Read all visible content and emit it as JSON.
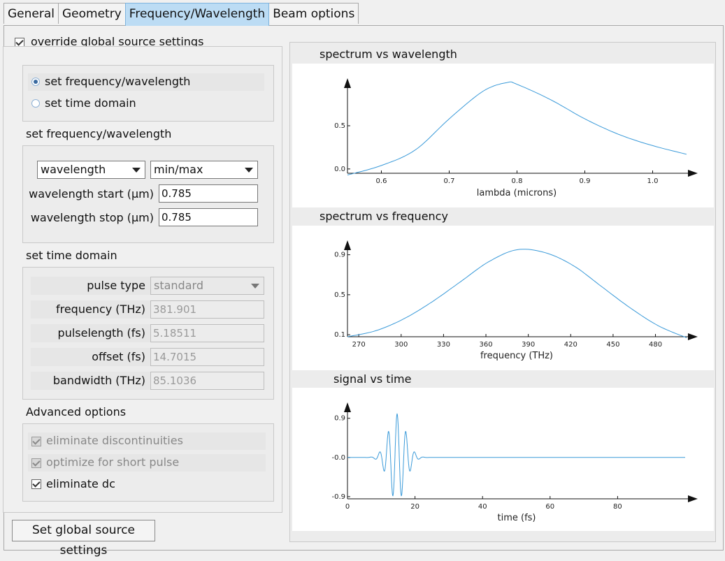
{
  "tabs": [
    "General",
    "Geometry",
    "Frequency/Wavelength",
    "Beam options"
  ],
  "override": {
    "label": "override global source settings",
    "checked": true
  },
  "mode": {
    "option1": "set frequency/wavelength",
    "option2": "set time domain",
    "selected": "set frequency/wavelength"
  },
  "freq_section": {
    "title": "set frequency/wavelength",
    "quantity_select": "wavelength",
    "range_select": "min/max",
    "start_label": "wavelength start (μm)",
    "start_value": "0.785",
    "stop_label": "wavelength stop (μm)",
    "stop_value": "0.785"
  },
  "time_section": {
    "title": "set time domain",
    "pulse_type_label": "pulse type",
    "pulse_type_value": "standard",
    "frequency_label": "frequency (THz)",
    "frequency_value": "381.901",
    "pulselength_label": "pulselength (fs)",
    "pulselength_value": "5.18511",
    "offset_label": "offset (fs)",
    "offset_value": "14.7015",
    "bandwidth_label": "bandwidth (THz)",
    "bandwidth_value": "85.1036"
  },
  "advanced": {
    "title": "Advanced options",
    "opt1": "eliminate discontinuities",
    "opt2": "optimize for short pulse",
    "opt3": "eliminate dc"
  },
  "set_global_button": "Set global source settings",
  "colors": {
    "tab_active": "#bcdcf4",
    "curve": "#3a9ad9"
  },
  "chart_data": [
    {
      "type": "line",
      "title": "spectrum vs wavelength",
      "xlabel": "lambda (microns)",
      "ylabel": "",
      "xlim": [
        0.55,
        1.05
      ],
      "ylim": [
        -0.05,
        1.05
      ],
      "xticks": [
        "0.6",
        "0.7",
        "0.8",
        "0.9",
        "1.0"
      ],
      "yticks": [
        "0.0",
        "0.5"
      ],
      "series": [
        {
          "x": [
            0.55,
            0.6,
            0.65,
            0.7,
            0.75,
            0.785,
            0.8,
            0.85,
            0.9,
            0.95,
            1.0,
            1.05
          ],
          "values": [
            -0.07,
            0.04,
            0.22,
            0.58,
            0.9,
            1.0,
            0.98,
            0.8,
            0.58,
            0.4,
            0.27,
            0.17
          ]
        }
      ]
    },
    {
      "type": "line",
      "title": "spectrum vs frequency",
      "xlabel": "frequency (THz)",
      "ylabel": "",
      "xlim": [
        262,
        502
      ],
      "ylim": [
        0.08,
        1.03
      ],
      "xticks": [
        "270",
        "300",
        "330",
        "360",
        "390",
        "420",
        "450",
        "480"
      ],
      "yticks": [
        "0.1",
        "0.5",
        "0.9"
      ],
      "series": [
        {
          "x": [
            262,
            282,
            302,
            322,
            342,
            362,
            382,
            402,
            422,
            442,
            462,
            482,
            502
          ],
          "values": [
            0.08,
            0.14,
            0.26,
            0.43,
            0.63,
            0.83,
            0.95,
            0.92,
            0.79,
            0.58,
            0.37,
            0.19,
            0.07
          ]
        }
      ]
    },
    {
      "type": "line",
      "title": "signal vs time",
      "xlabel": "time (fs)",
      "ylabel": "",
      "xlim": [
        0,
        100
      ],
      "ylim": [
        -0.95,
        1.2
      ],
      "xticks": [
        "0",
        "20",
        "40",
        "60",
        "80"
      ],
      "yticks": [
        "0.9",
        "-0.0",
        "-0.9"
      ],
      "pulse": {
        "center_fs": 14.7015,
        "pulselength_fs": 5.18511,
        "frequency_thz": 381.901,
        "period_fs": 2.6,
        "t_end": 100
      }
    }
  ]
}
